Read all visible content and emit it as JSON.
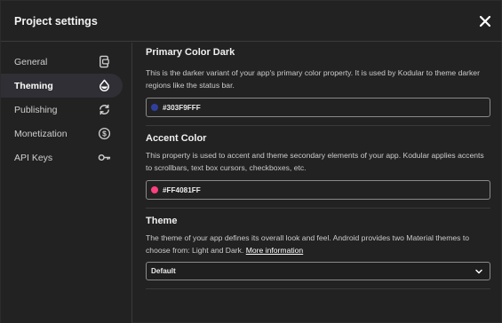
{
  "dialog": {
    "title": "Project settings",
    "close_icon": "close-icon"
  },
  "sidebar": {
    "items": [
      {
        "label": "General",
        "icon": "phone-settings-icon",
        "active": false
      },
      {
        "label": "Theming",
        "icon": "paint-drop-icon",
        "active": true
      },
      {
        "label": "Publishing",
        "icon": "sync-icon",
        "active": false
      },
      {
        "label": "Monetization",
        "icon": "dollar-icon",
        "active": false
      },
      {
        "label": "API Keys",
        "icon": "key-icon",
        "active": false
      }
    ]
  },
  "sections": {
    "primary_dark": {
      "title": "Primary Color Dark",
      "description": "This is the darker variant of your app's primary color property. It is used by Kodular to theme darker regions like the status bar.",
      "value": "#303F9FFF",
      "swatch": "#303F9F"
    },
    "accent": {
      "title": "Accent Color",
      "description": "This property is used to accent and theme secondary elements of your app. Kodular applies accents to scrollbars, text box cursors, checkboxes, etc.",
      "value": "#FF4081FF",
      "swatch": "#FF4081"
    },
    "theme": {
      "title": "Theme",
      "description": "The theme of your app defines its overall look and feel. Android provides two Material themes to choose from: Light and Dark.",
      "link": "More information",
      "selected": "Default"
    }
  },
  "colors": {
    "background": "#222222",
    "active_item": "#2f2f35",
    "border": "#8a8a8a"
  }
}
